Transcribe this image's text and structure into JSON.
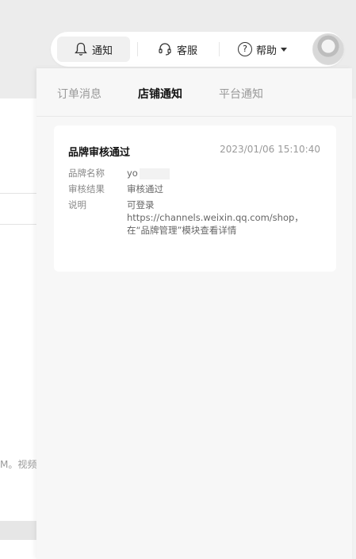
{
  "background": {
    "fragment_text": "M。视频"
  },
  "toolbar": {
    "notify_label": "通知",
    "service_label": "客服",
    "help_label": "帮助",
    "help_glyph": "?"
  },
  "panel": {
    "tabs": [
      {
        "label": "订单消息"
      },
      {
        "label": "店铺通知"
      },
      {
        "label": "平台通知"
      }
    ],
    "notification": {
      "title": "品牌审核通过",
      "time": "2023/01/06 15:10:40",
      "brand_name_key": "品牌名称",
      "brand_name_value": "yo",
      "result_key": "审核结果",
      "result_value": "审核通过",
      "note_key": "说明",
      "note_line1": "可登录",
      "note_line2": "https://channels.weixin.qq.com/shop，",
      "note_line3": "在“品牌管理”模块查看详情"
    }
  }
}
